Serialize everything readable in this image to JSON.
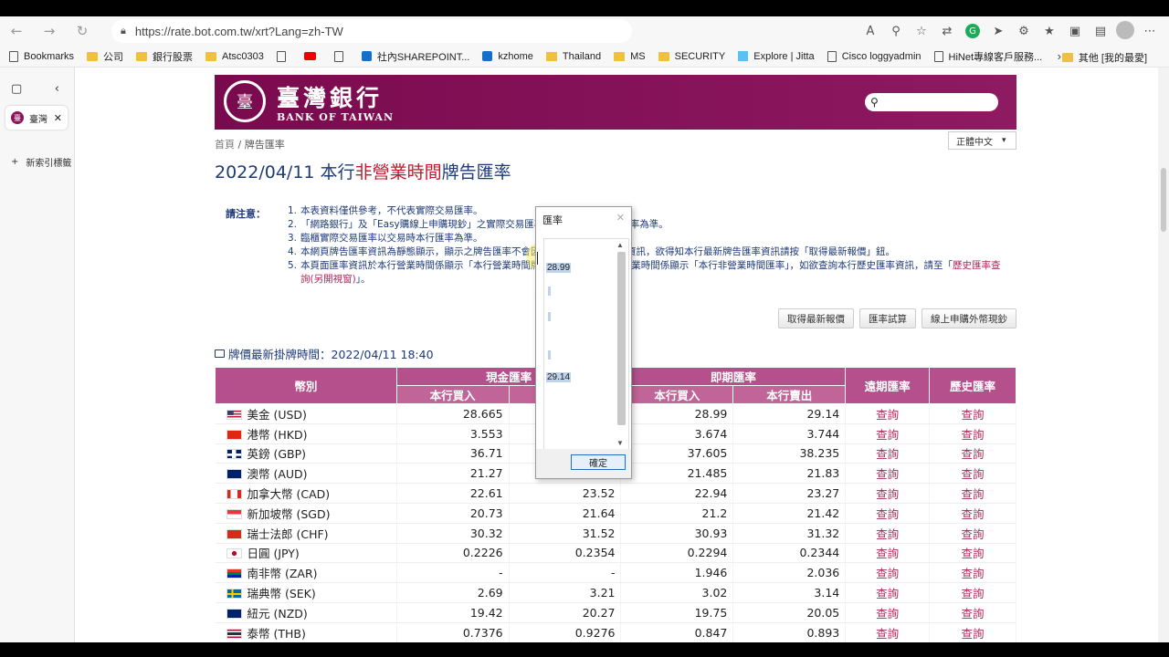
{
  "browser": {
    "url": "https://rate.bot.com.tw/xrt?Lang=zh-TW",
    "bookmarks": [
      "Bookmarks",
      "公司",
      "銀行股票",
      "Atsc0303",
      "",
      "",
      "社內SHAREPOINT...",
      "kzhome",
      "Thailand",
      "MS",
      "SECURITY",
      "Explore | Jitta",
      "Cisco loggyadmin",
      "HiNet專線客戶服務..."
    ],
    "other_bookmarks": "其他 [我的最愛]",
    "tab_title": "臺灣",
    "new_tab": "新索引標籤"
  },
  "header": {
    "logo_cn": "臺灣銀行",
    "logo_en": "BANK OF TAIWAN",
    "language": "正體中文"
  },
  "breadcrumb": {
    "home": "首頁",
    "sep": "/",
    "current": "牌告匯率"
  },
  "title": {
    "date": "2022/04/11",
    "prefix": " 本行",
    "highlight": "非營業時間",
    "suffix": "牌告匯率"
  },
  "notice": {
    "label": "請注意：",
    "items": [
      {
        "num": "1.",
        "text": "本表資料僅供參考，不代表實際交易匯率。"
      },
      {
        "num": "2.",
        "text": "「網路銀行」及「Easy購線上申購現鈔」之實際交易匯率請以交易時顯示之匯率為準。"
      },
      {
        "num": "3.",
        "text": "臨櫃實際交易匯率以交易時本行匯率為準。"
      },
      {
        "num": "4.",
        "text": "本網頁牌告匯率資訊為靜態顯示，顯示之牌告匯率不會因匯率變動而自動更新資訊，欲得知本行最新牌告匯率資訊請按「取得最新報價」鈕。"
      },
      {
        "num": "5.",
        "text": "本頁面匯率資訊於本行營業時間係顯示「本行營業時間牌告匯率」，於本行非營業時間係顯示「本行非營業時間匯率」，如欲查詢本行歷史匯率資訊，請至「",
        "link": "歷史匯率查詢(另開視窗)",
        "tail": "」。"
      }
    ]
  },
  "buttons": {
    "refresh": "取得最新報價",
    "calc": "匯率試算",
    "buy_cash": "線上申購外幣現鈔"
  },
  "updated": "牌價最新掛牌時間：2022/04/11 18:40",
  "table": {
    "h_currency": "幣別",
    "h_cash": "現金匯率",
    "h_spot": "即期匯率",
    "h_forward": "遠期匯率",
    "h_history": "歷史匯率",
    "h_buy": "本行買入",
    "h_sell": "本行賣出",
    "query": "查詢",
    "rows": [
      {
        "name": "美金 (USD)",
        "cash_buy": "28.665",
        "cash_sell": "",
        "spot_buy": "28.99",
        "spot_sell": "29.14",
        "flag": "us"
      },
      {
        "name": "港幣 (HKD)",
        "cash_buy": "3.553",
        "cash_sell": "",
        "spot_buy": "3.674",
        "spot_sell": "3.744",
        "flag": "hk"
      },
      {
        "name": "英鎊 (GBP)",
        "cash_buy": "36.71",
        "cash_sell": "",
        "spot_buy": "37.605",
        "spot_sell": "38.235",
        "flag": "gb"
      },
      {
        "name": "澳幣 (AUD)",
        "cash_buy": "21.27",
        "cash_sell": "22.05",
        "spot_buy": "21.485",
        "spot_sell": "21.83",
        "flag": "au"
      },
      {
        "name": "加拿大幣 (CAD)",
        "cash_buy": "22.61",
        "cash_sell": "23.52",
        "spot_buy": "22.94",
        "spot_sell": "23.27",
        "flag": "ca"
      },
      {
        "name": "新加坡幣 (SGD)",
        "cash_buy": "20.73",
        "cash_sell": "21.64",
        "spot_buy": "21.2",
        "spot_sell": "21.42",
        "flag": "sg"
      },
      {
        "name": "瑞士法郎 (CHF)",
        "cash_buy": "30.32",
        "cash_sell": "31.52",
        "spot_buy": "30.93",
        "spot_sell": "31.32",
        "flag": "ch"
      },
      {
        "name": "日圓 (JPY)",
        "cash_buy": "0.2226",
        "cash_sell": "0.2354",
        "spot_buy": "0.2294",
        "spot_sell": "0.2344",
        "flag": "jp"
      },
      {
        "name": "南非幣 (ZAR)",
        "cash_buy": "-",
        "cash_sell": "-",
        "spot_buy": "1.946",
        "spot_sell": "2.036",
        "flag": "za"
      },
      {
        "name": "瑞典幣 (SEK)",
        "cash_buy": "2.69",
        "cash_sell": "3.21",
        "spot_buy": "3.02",
        "spot_sell": "3.14",
        "flag": "se"
      },
      {
        "name": "紐元 (NZD)",
        "cash_buy": "19.42",
        "cash_sell": "20.27",
        "spot_buy": "19.75",
        "spot_sell": "20.05",
        "flag": "nz"
      },
      {
        "name": "泰幣 (THB)",
        "cash_buy": "0.7376",
        "cash_sell": "0.9276",
        "spot_buy": "0.847",
        "spot_sell": "0.893",
        "flag": "th"
      }
    ]
  },
  "dialog": {
    "title": "匯率",
    "top_value": "28.99",
    "bottom_value": "29.14",
    "ok": "確定"
  },
  "colors": {
    "brand": "#8a1459",
    "header_row": "#b5508c",
    "title_blue": "#1e3a78",
    "highlight_red": "#c0182c"
  }
}
